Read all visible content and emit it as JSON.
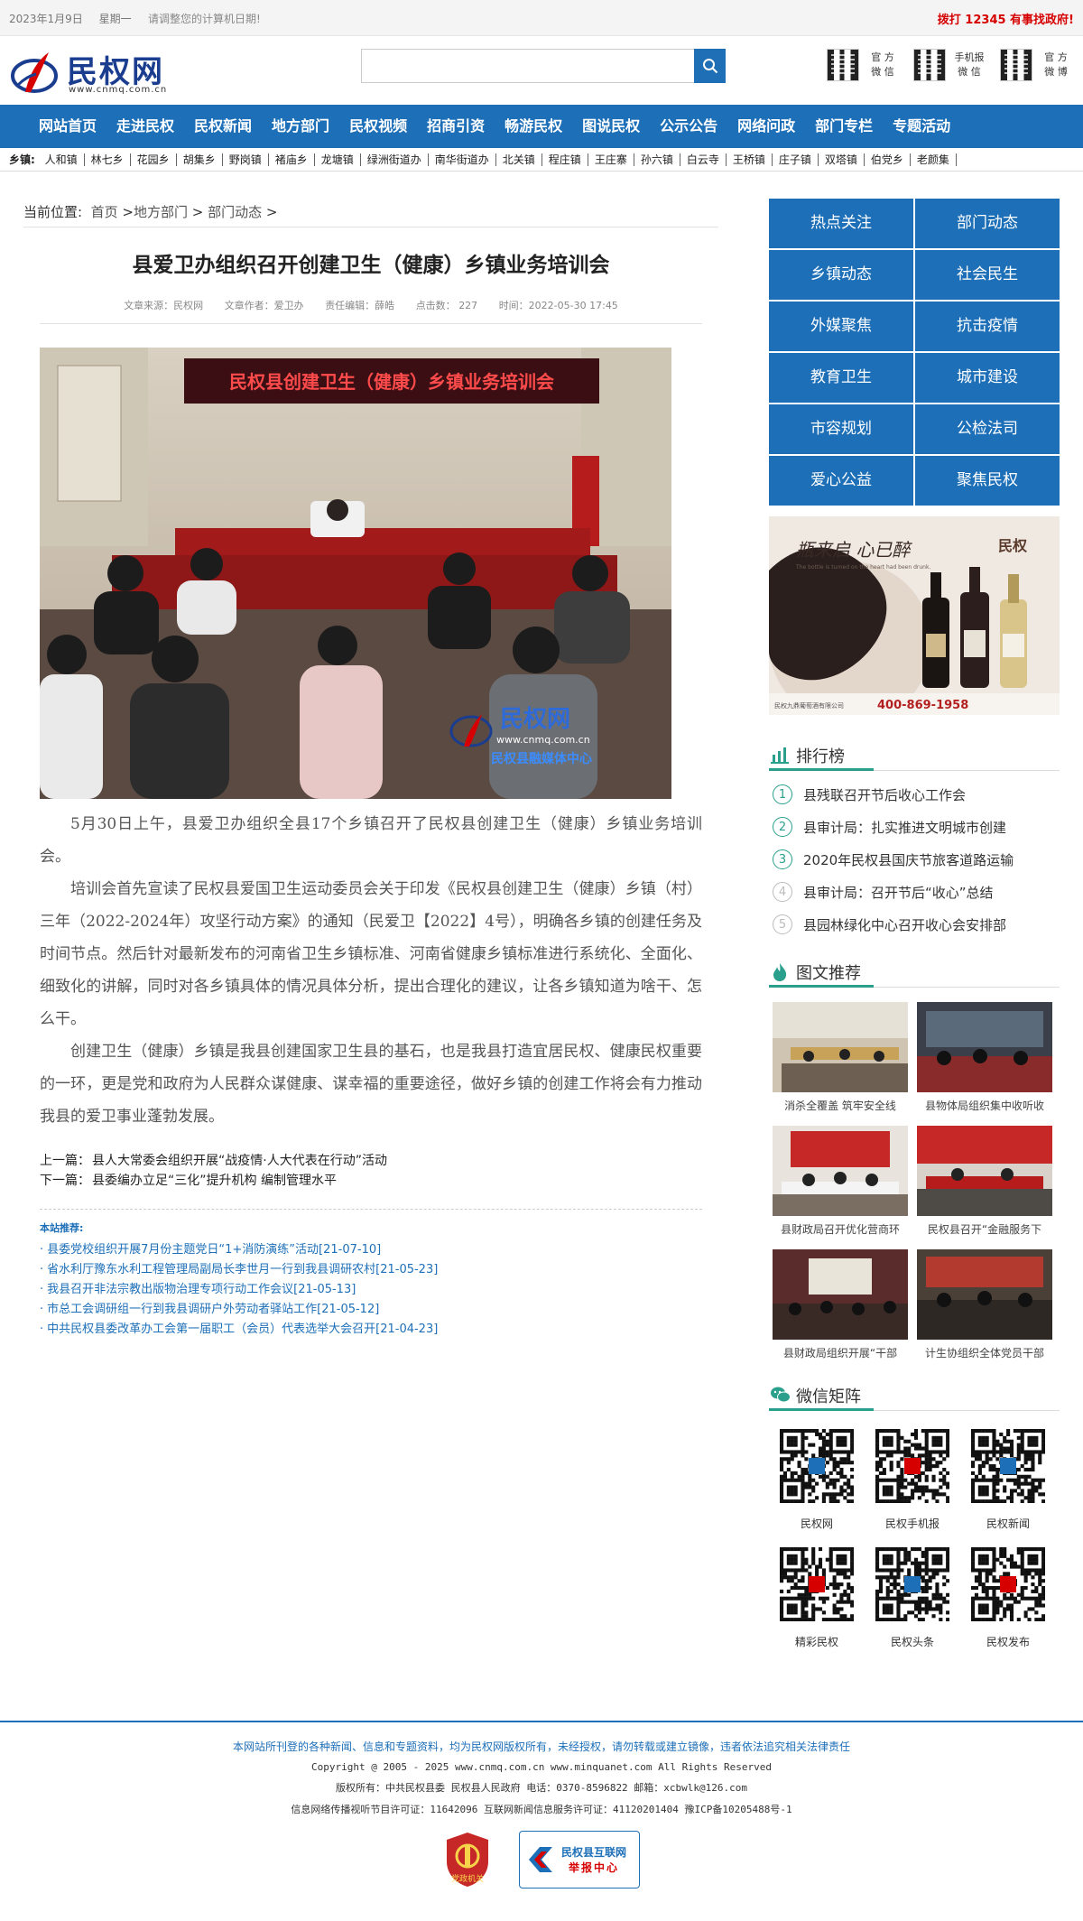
{
  "topbar": {
    "date": "2023年1月9日",
    "weekday": "星期一",
    "tip": "请调整您的计算机日期!",
    "hotline": "拨打 12345 有事找政府!"
  },
  "logo": {
    "name": "民权网",
    "url": "www.cnmq.com.cn"
  },
  "search": {
    "placeholder": "",
    "button_icon": "search-icon"
  },
  "header_qr": [
    {
      "l1": "官 方",
      "l2": "微 信"
    },
    {
      "l1": "手机报",
      "l2": "微 信"
    },
    {
      "l1": "官 方",
      "l2": "微 博"
    }
  ],
  "nav": [
    "网站首页",
    "走进民权",
    "民权新闻",
    "地方部门",
    "民权视频",
    "招商引资",
    "畅游民权",
    "图说民权",
    "公示公告",
    "网络问政",
    "部门专栏",
    "专题活动"
  ],
  "towns": {
    "label": "乡镇:",
    "items": [
      "人和镇",
      "林七乡",
      "花园乡",
      "胡集乡",
      "野岗镇",
      "褚庙乡",
      "龙塘镇",
      "绿洲街道办",
      "南华街道办",
      "北关镇",
      "程庄镇",
      "王庄寨",
      "孙六镇",
      "白云寺",
      "王桥镇",
      "庄子镇",
      "双塔镇",
      "伯党乡",
      "老颜集"
    ]
  },
  "breadcrumb": {
    "label": "当前位置:",
    "items": [
      "首页",
      "地方部门",
      "部门动态"
    ]
  },
  "article": {
    "title": "县爱卫办组织召开创建卫生（健康）乡镇业务培训会",
    "meta": {
      "source": "文章来源：民权网",
      "author": "文章作者：爱卫办",
      "editor": "责任编辑：薛皓",
      "clicks_label": "点击数：",
      "clicks": "227",
      "time": "时间：2022-05-30 17:45"
    },
    "photo": {
      "banner": "民权县创建卫生（健康）乡镇业务培训会",
      "watermark_name": "民权网",
      "watermark_url": "www.cnmq.com.cn",
      "watermark_sub": "民权县融媒体中心"
    },
    "paragraphs": [
      "5月30日上午，县爱卫办组织全县17个乡镇召开了民权县创建卫生（健康）乡镇业务培训会。",
      "培训会首先宣读了民权县爱国卫生运动委员会关于印发《民权县创建卫生（健康）乡镇（村）三年（2022-2024年）攻坚行动方案》的通知（民爱卫【2022】4号），明确各乡镇的创建任务及时间节点。然后针对最新发布的河南省卫生乡镇标准、河南省健康乡镇标准进行系统化、全面化、细致化的讲解，同时对各乡镇具体的情况具体分析，提出合理化的建议，让各乡镇知道为啥干、怎么干。",
      "创建卫生（健康）乡镇是我县创建国家卫生县的基石，也是我县打造宜居民权、健康民权重要的一环，更是党和政府为人民群众谋健康、谋幸福的重要途径，做好乡镇的创建工作将会有力推动我县的爱卫事业蓬勃发展。"
    ],
    "prev": {
      "label": "上一篇：",
      "title": "县人大常委会组织开展“战疫情·人大代表在行动”活动"
    },
    "next": {
      "label": "下一篇：",
      "title": "县委编办立足“三化”提升机构 编制管理水平"
    }
  },
  "recommend": {
    "heading": "本站推荐:",
    "items": [
      "县委党校组织开展7月份主题党日“1+消防演练”活动[21-07-10]",
      "省水利厅豫东水利工程管理局副局长李世月一行到我县调研农村[21-05-23]",
      "我县召开非法宗教出版物治理专项行动工作会议[21-05-13]",
      "市总工会调研组一行到我县调研户外劳动者驿站工作[21-05-12]",
      "中共民权县委改革办工会第一届职工（会员）代表选举大会召开[21-04-23]"
    ]
  },
  "sidebar": {
    "categories": [
      "热点关注",
      "部门动态",
      "乡镇动态",
      "社会民生",
      "外媒聚焦",
      "抗击疫情",
      "教育卫生",
      "城市建设",
      "市容规划",
      "公检法司",
      "爱心公益",
      "聚焦民权"
    ],
    "ad": {
      "slogan": "瓶来启 心已醉",
      "slogan_en": "The bottle is turned on the heart had been drunk.",
      "brand": "民权",
      "company": "民权九鼎葡萄酒有限公司",
      "phone": "400-869-1958"
    },
    "ranking": {
      "title": "排行榜",
      "items": [
        "县残联召开节后收心工作会",
        "县审计局：扎实推进文明城市创建",
        "2020年民权县国庆节旅客道路运输",
        "县审计局：召开节后“收心”总结",
        "县园林绿化中心召开收心会安排部"
      ]
    },
    "pictures": {
      "title": "图文推荐",
      "items": [
        "消杀全覆盖 筑牢安全线",
        "县物体局组织集中收听收",
        "县财政局召开优化营商环",
        "民权县召开“金融服务下",
        "县财政局组织开展“干部",
        "计生协组织全体党员干部"
      ]
    },
    "wechat": {
      "title": "微信矩阵",
      "items": [
        "民权网",
        "民权手机报",
        "民权新闻",
        "精彩民权",
        "民权头条",
        "民权发布"
      ]
    }
  },
  "footer": {
    "line1": "本网站所刊登的各种新闻、信息和专题资料，均为民权网版权所有，未经授权，请勿转载或建立镜像，违者依法追究相关法律责任",
    "line2": "Copyright @ 2005 - 2025 www.cnmq.com.cn www.minquanet.com All Rights Reserved",
    "line3": "版权所有：中共民权县委 民权县人民政府 电话：0370-8596822 邮箱：xcbwlk@126.com",
    "line4": "信息网络传播视听节目许可证：11642096 互联网新闻信息服务许可证：41120201404 豫ICP备10205488号-1",
    "badge1": "党政机关",
    "badge2_l1": "民权县互联网",
    "badge2_l2": "举报中心"
  },
  "colors": {
    "brand_blue": "#1d6fb8",
    "accent_red": "#d60000",
    "accent_green": "#2aa08c"
  }
}
